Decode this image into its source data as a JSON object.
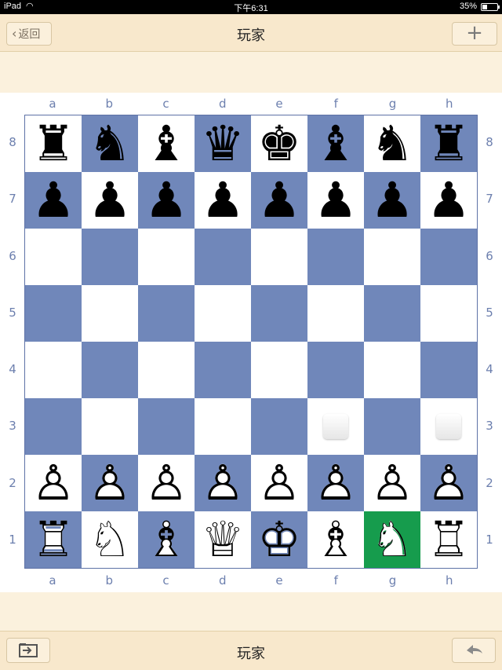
{
  "status_bar": {
    "carrier": "iPad",
    "time": "下午6:31",
    "battery": "35%",
    "battery_level": 0.35
  },
  "nav": {
    "back_label": "返回",
    "title": "玩家",
    "add_label": "+"
  },
  "toolbar": {
    "title": "玩家"
  },
  "board": {
    "files": [
      "a",
      "b",
      "c",
      "d",
      "e",
      "f",
      "g",
      "h"
    ],
    "ranks": [
      "8",
      "7",
      "6",
      "5",
      "4",
      "3",
      "2",
      "1"
    ],
    "position": [
      [
        "bR",
        "bN",
        "bB",
        "bQ",
        "bK",
        "bB",
        "bN",
        "bR"
      ],
      [
        "bP",
        "bP",
        "bP",
        "bP",
        "bP",
        "bP",
        "bP",
        "bP"
      ],
      [
        "",
        "",
        "",
        "",
        "",
        "",
        "",
        ""
      ],
      [
        "",
        "",
        "",
        "",
        "",
        "",
        "",
        ""
      ],
      [
        "",
        "",
        "",
        "",
        "",
        "",
        "",
        ""
      ],
      [
        "",
        "",
        "",
        "",
        "",
        "",
        "",
        ""
      ],
      [
        "wP",
        "wP",
        "wP",
        "wP",
        "wP",
        "wP",
        "wP",
        "wP"
      ],
      [
        "wR",
        "wN",
        "wB",
        "wQ",
        "wK",
        "wB",
        "wN",
        "wR"
      ]
    ],
    "selected_square": "g1",
    "move_hints": [
      "f3",
      "h3"
    ],
    "colors": {
      "light": "#ffffff",
      "dark": "#7087ba",
      "selected": "#169c4d"
    }
  }
}
